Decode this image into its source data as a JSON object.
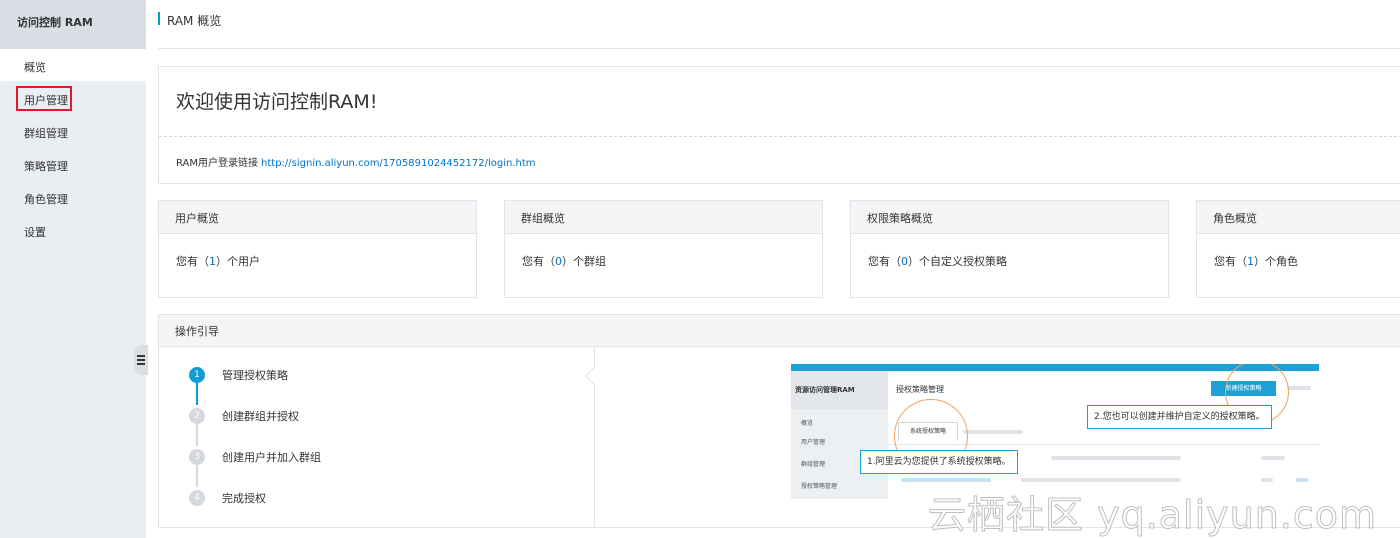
{
  "sidebar": {
    "title": "访问控制 RAM",
    "items": [
      {
        "label": "概览"
      },
      {
        "label": "用户管理"
      },
      {
        "label": "群组管理"
      },
      {
        "label": "策略管理"
      },
      {
        "label": "角色管理"
      },
      {
        "label": "设置"
      }
    ]
  },
  "header": {
    "title": "RAM 概览"
  },
  "welcome": {
    "title": "欢迎使用访问控制RAM!",
    "login_label": "RAM用户登录链接",
    "login_url": "http://signin.aliyun.com/1705891024452172/login.htm"
  },
  "cards": [
    {
      "title": "用户概览",
      "prefix": "您有（",
      "count": "1",
      "suffix": "）个用户"
    },
    {
      "title": "群组概览",
      "prefix": "您有（",
      "count": "0",
      "suffix": "）个群组"
    },
    {
      "title": "权限策略概览",
      "prefix": "您有（",
      "count": "0",
      "suffix": "）个自定义授权策略"
    },
    {
      "title": "角色概览",
      "prefix": "您有（",
      "count": "1",
      "suffix": "）个角色"
    }
  ],
  "guide": {
    "title": "操作引导",
    "steps": [
      {
        "num": "1",
        "label": "管理授权策略"
      },
      {
        "num": "2",
        "label": "创建群组并授权"
      },
      {
        "num": "3",
        "label": "创建用户并加入群组"
      },
      {
        "num": "4",
        "label": "完成授权"
      }
    ],
    "illustration": {
      "side_title": "资源访问管理RAM",
      "side_items": [
        "概览",
        "用户管理",
        "群组管理",
        "授权策略管理"
      ],
      "page_title": "授权策略管理",
      "new_button": "新建授权策略",
      "tab_label": "系统授权策略",
      "tip1": "1.阿里云为您提供了系统授权策略。",
      "tip2": "2.您也可以创建并维护自定义的授权策略。"
    }
  },
  "watermark": "云栖社区 yq.aliyun.com",
  "colors": {
    "accent": "#0070cc",
    "step_active": "#0e9ed5",
    "highlight": "#e0192d"
  }
}
